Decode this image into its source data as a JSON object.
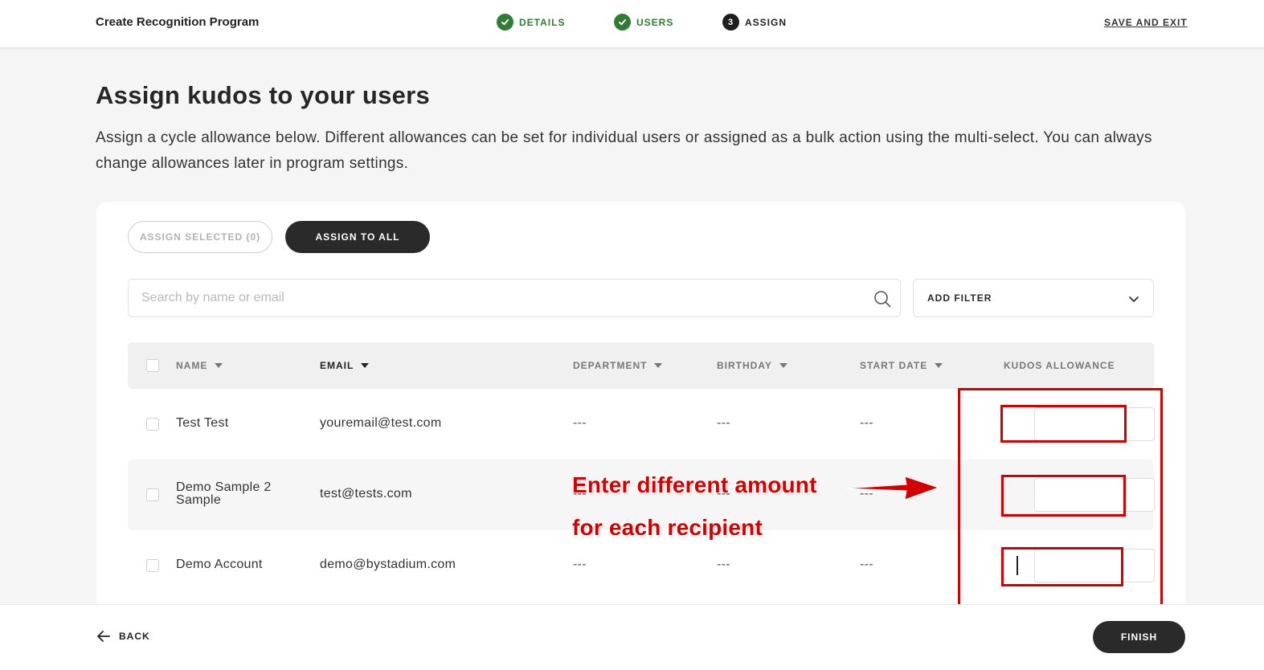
{
  "header": {
    "title": "Create Recognition Program",
    "steps": [
      {
        "number": "1",
        "label": "DETAILS",
        "state": "done"
      },
      {
        "number": "2",
        "label": "USERS",
        "state": "done"
      },
      {
        "number": "3",
        "label": "ASSIGN",
        "state": "current"
      }
    ],
    "save_exit": "SAVE AND EXIT"
  },
  "intro": {
    "title": "Assign kudos to your users",
    "description": "Assign a cycle allowance below. Different allowances can be set for individual users or assigned as a bulk action using the multi-select. You can always change allowances later in program settings."
  },
  "actions": {
    "assign_selected": "ASSIGN SELECTED (0)",
    "assign_all": "ASSIGN TO ALL"
  },
  "search": {
    "placeholder": "Search by name or email",
    "filter_label": "ADD FILTER"
  },
  "table": {
    "columns": {
      "name": "NAME",
      "email": "EMAIL",
      "department": "DEPARTMENT",
      "birthday": "BIRTHDAY",
      "start_date": "START DATE",
      "allowance": "KUDOS ALLOWANCE"
    },
    "rows": [
      {
        "name": "Test Test",
        "email": "youremail@test.com",
        "department": "---",
        "birthday": "---",
        "start_date": "---",
        "allowance": ""
      },
      {
        "name": "Demo Sample 2 Sample",
        "email": "test@tests.com",
        "department": "---",
        "birthday": "---",
        "start_date": "---",
        "allowance": ""
      },
      {
        "name": "Demo Account",
        "email": "demo@bystadium.com",
        "department": "---",
        "birthday": "---",
        "start_date": "---",
        "allowance": ""
      }
    ]
  },
  "annotation": {
    "line1": "Enter different amount",
    "line2": "for each recipient",
    "color": "#d40000"
  },
  "footer": {
    "back": "BACK",
    "finish": "FINISH"
  },
  "colors": {
    "success": "#2e7d32",
    "dark": "#2a2a2a",
    "background": "#f5f5f5"
  }
}
